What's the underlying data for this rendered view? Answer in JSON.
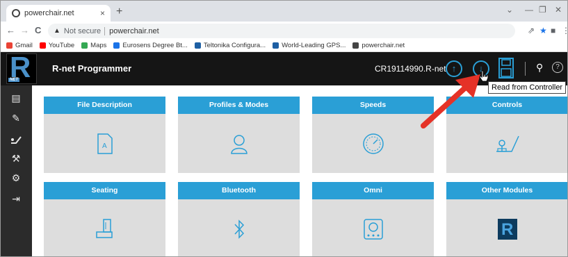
{
  "browser": {
    "tab_title": "powerchair.net",
    "tab_close": "×",
    "new_tab": "+",
    "win_min": "—",
    "win_restore": "❐",
    "win_close": "✕",
    "win_chevron": "⌄",
    "back": "←",
    "forward": "→",
    "reload": "C",
    "security": "Not secure",
    "url": "powerchair.net",
    "bookmarks": [
      {
        "label": "Gmail",
        "color": "#ea4335"
      },
      {
        "label": "YouTube",
        "color": "#ff0000"
      },
      {
        "label": "Maps",
        "color": "#34a853"
      },
      {
        "label": "Eurosens Degree Bt...",
        "color": "#1a73e8"
      },
      {
        "label": "Teltonika Configura...",
        "color": "#1d5fa3"
      },
      {
        "label": "World-Leading GPS...",
        "color": "#1d5fa3"
      },
      {
        "label": "powerchair.net",
        "color": "#444444"
      }
    ]
  },
  "app": {
    "logo": "R",
    "logo_tag": "NET",
    "title": "R-net Programmer",
    "device": "CR19114990.R-net",
    "upload_icon": "↑",
    "download_icon": "↓",
    "search_icon": "⚲",
    "help_icon": "?",
    "tooltip": "Read from Controller"
  },
  "sidebar": {
    "icons": [
      "document-icon",
      "pencil-icon",
      "chair-control-icon",
      "wrench-icon",
      "gear-icon",
      "exit-icon"
    ]
  },
  "cards": [
    {
      "label": "File Description",
      "icon": "file-icon"
    },
    {
      "label": "Profiles & Modes",
      "icon": "profile-icon"
    },
    {
      "label": "Speeds",
      "icon": "speedometer-icon"
    },
    {
      "label": "Controls",
      "icon": "joystick-icon"
    },
    {
      "label": "Seating",
      "icon": "seat-icon"
    },
    {
      "label": "Bluetooth",
      "icon": "bluetooth-icon"
    },
    {
      "label": "Omni",
      "icon": "omni-device-icon"
    },
    {
      "label": "Other Modules",
      "icon": "rnet-module-icon"
    }
  ],
  "colors": {
    "accent": "#2a9fd6",
    "topbar": "#151515",
    "sidebar": "#2b2b2b",
    "card_body": "#dddddd",
    "arrow": "#e53227"
  }
}
